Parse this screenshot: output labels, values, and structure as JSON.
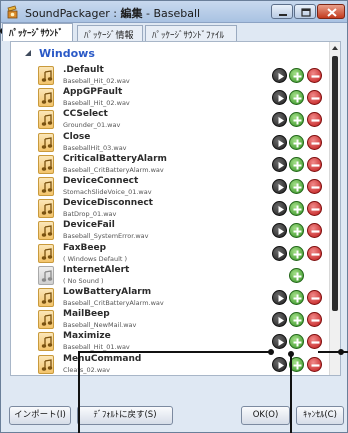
{
  "window": {
    "title_app": "SoundPackager",
    "title_sep1": " : ",
    "title_mode": "編集",
    "title_sep2": " - ",
    "title_package": "Baseball"
  },
  "tabs": [
    {
      "label": "ﾊﾟｯｹｰｼﾞｻｳﾝﾄﾞ",
      "active": true
    },
    {
      "label": "ﾊﾟｯｹｰｼﾞ情報",
      "active": false
    },
    {
      "label": "ﾊﾟｯｹｰｼﾞｻｳﾝﾄﾞﾌｧｲﾙ",
      "active": false
    }
  ],
  "group": {
    "title": "Windows",
    "expanded": true
  },
  "rows": [
    {
      "name": ".Default",
      "file": "Baseball_Hit_02.wav",
      "has_sound": true
    },
    {
      "name": "AppGPFault",
      "file": "Baseball_Hit_02.wav",
      "has_sound": true
    },
    {
      "name": "CCSelect",
      "file": "Grounder_01.wav",
      "has_sound": true
    },
    {
      "name": "Close",
      "file": "BaseballHit_03.wav",
      "has_sound": true
    },
    {
      "name": "CriticalBatteryAlarm",
      "file": "Baseball_CritBatteryAlarm.wav",
      "has_sound": true
    },
    {
      "name": "DeviceConnect",
      "file": "StomachSlideVoice_01.wav",
      "has_sound": true
    },
    {
      "name": "DeviceDisconnect",
      "file": "BatDrop_01.wav",
      "has_sound": true
    },
    {
      "name": "DeviceFail",
      "file": "Baseball_SystemError.wav",
      "has_sound": true
    },
    {
      "name": "FaxBeep",
      "file": "( Windows Default )",
      "has_sound": true
    },
    {
      "name": "InternetAlert",
      "file": "( No Sound )",
      "has_sound": false
    },
    {
      "name": "LowBatteryAlarm",
      "file": "Baseball_CritBatteryAlarm.wav",
      "has_sound": true
    },
    {
      "name": "MailBeep",
      "file": "Baseball_NewMail.wav",
      "has_sound": true
    },
    {
      "name": "Maximize",
      "file": "Baseball_Hit_01.wav",
      "has_sound": true
    },
    {
      "name": "MenuCommand",
      "file": "Cleats_02.wav",
      "has_sound": true
    }
  ],
  "buttons": {
    "import": "インポート(I)",
    "default": "ﾃﾞﾌｫﾙﾄに戻す(S)",
    "ok": "OK(O)",
    "cancel": "ｷｬﾝｾﾙ(C)"
  },
  "colors": {
    "group_title": "#2a59c7",
    "play": "#1e1e1e",
    "add": "#2f8f1e",
    "remove": "#c01818"
  }
}
